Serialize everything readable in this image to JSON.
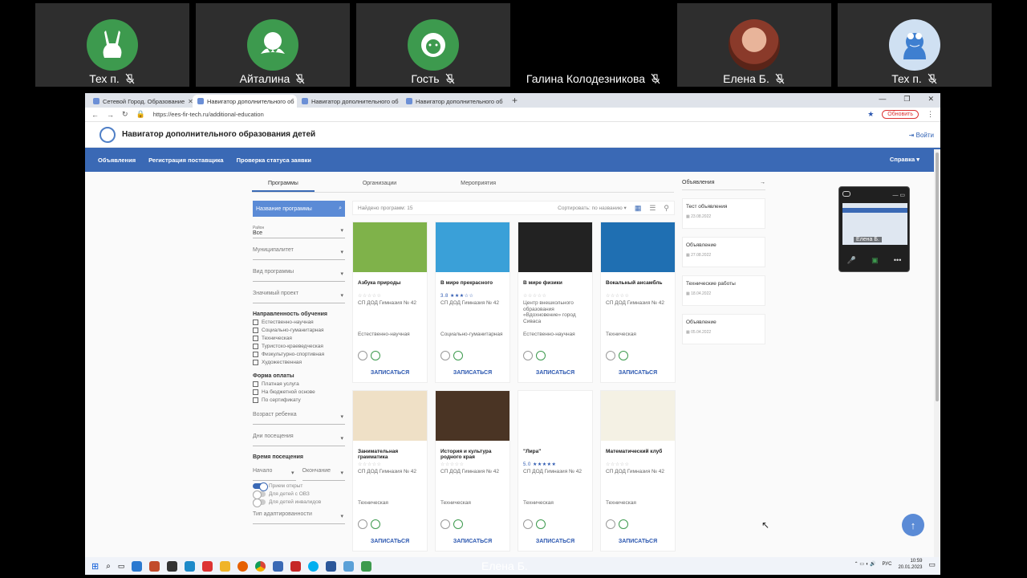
{
  "participants": [
    {
      "name": "Тех п.",
      "avatar": "rabbit-icon"
    },
    {
      "name": "Айталина",
      "avatar": "octopus-icon"
    },
    {
      "name": "Гость",
      "avatar": "lion-icon"
    },
    {
      "name": "Галина Колодезникова",
      "avatar": "none"
    },
    {
      "name": "Елена Б.",
      "avatar": "photo"
    },
    {
      "name": "Тех п.",
      "avatar": "frog-icon"
    }
  ],
  "browser": {
    "tabs": [
      "Сетевой Город. Образование",
      "Навигатор дополнительного об",
      "Навигатор дополнительного об",
      "Навигатор дополнительного об"
    ],
    "url": "https://ees-fir-tech.ru/additional-education",
    "refresh_label": "Обновить"
  },
  "site": {
    "title": "Навигатор дополнительного образования детей",
    "login": "Войти",
    "nav": [
      "Объявления",
      "Регистрация поставщика",
      "Проверка статуса заявки"
    ],
    "help": "Справка"
  },
  "subtabs": [
    "Программы",
    "Организации",
    "Мероприятия"
  ],
  "filters": {
    "search_placeholder": "Название программы",
    "district_label": "Район",
    "district_value": "Все",
    "municipality": "Муниципалитет",
    "program_type": "Вид программы",
    "project": "Значимый проект",
    "direction_title": "Направленность обучения",
    "directions": [
      "Естественно-научная",
      "Социально-гуманитарная",
      "Техническая",
      "Туристско-краеведческая",
      "Физкультурно-спортивная",
      "Художественная"
    ],
    "payment_title": "Форма оплаты",
    "payments": [
      "Платная услуга",
      "На бюджетной основе",
      "По сертификату"
    ],
    "age": "Возраст ребенка",
    "days": "Дни посещения",
    "time_title": "Время посещения",
    "time_start": "Начало",
    "time_end": "Окончание",
    "toggles": [
      {
        "label": "Прием открыт",
        "on": true
      },
      {
        "label": "Для детей с ОВЗ",
        "on": false
      },
      {
        "label": "Для детей инвалидов",
        "on": false
      }
    ],
    "adapt": "Тип адаптированности"
  },
  "results": {
    "found": "Найдено программ: 15",
    "sort": "Сортировать: по названию"
  },
  "cards": [
    {
      "title": "Азбука природы",
      "rating": "",
      "stars": "☆☆☆☆☆",
      "org": "СП ДОД Гимназия № 42",
      "direction": "Естественно-научная",
      "enroll": "ЗАПИСАТЬСЯ",
      "img": "#7fb24a"
    },
    {
      "title": "В мире прекрасного",
      "rating": "3.8",
      "stars": "★★★☆☆",
      "org": "СП ДОД Гимназия № 42",
      "direction": "Социально-гуманитарная",
      "enroll": "ЗАПИСАТЬСЯ",
      "img": "#3aa0d8"
    },
    {
      "title": "В мире физики",
      "rating": "",
      "stars": "☆☆☆☆☆",
      "org": "Центр внешкольного образования «Вдохновение» город Сиваса",
      "direction": "Естественно-научная",
      "enroll": "ЗАПИСАТЬСЯ",
      "img": "#222222"
    },
    {
      "title": "Вокальный ансамбль",
      "rating": "",
      "stars": "☆☆☆☆☆",
      "org": "СП ДОД Гимназия № 42",
      "direction": "Техническая",
      "enroll": "ЗАПИСАТЬСЯ",
      "img": "#1f6fb2"
    },
    {
      "title": "Занимательная грамматика",
      "rating": "",
      "stars": "☆☆☆☆☆",
      "org": "СП ДОД Гимназия № 42",
      "direction": "Техническая",
      "enroll": "ЗАПИСАТЬСЯ",
      "img": "#efe0c6"
    },
    {
      "title": "История и культура родного края",
      "rating": "",
      "stars": "☆☆☆☆☆",
      "org": "СП ДОД Гимназия № 42",
      "direction": "Техническая",
      "enroll": "ЗАПИСАТЬСЯ",
      "img": "#4a3424"
    },
    {
      "title": "\"Лира\"",
      "rating": "5.0",
      "stars": "★★★★★",
      "org": "СП ДОД Гимназия № 42",
      "direction": "Техническая",
      "enroll": "ЗАПИСАТЬСЯ",
      "img": "#ffffff"
    },
    {
      "title": "Математический клуб",
      "rating": "",
      "stars": "☆☆☆☆☆",
      "org": "СП ДОД Гимназия № 42",
      "direction": "Техническая",
      "enroll": "ЗАПИСАТЬСЯ",
      "img": "#f4f1e4"
    }
  ],
  "news": {
    "title": "Объявления",
    "items": [
      {
        "title": "Тест объявления",
        "date": "23.08.2022"
      },
      {
        "title": "Объявление",
        "date": "27.08.2022"
      },
      {
        "title": "Технические работы",
        "date": "18.04.2022"
      },
      {
        "title": "Объявление",
        "date": "05.04.2022"
      }
    ]
  },
  "selfview": {
    "name": "Елена Б."
  },
  "presenter": "Елена Б.",
  "tray": {
    "lang": "РУС",
    "time": "10:59",
    "date": "20.01.2023"
  }
}
